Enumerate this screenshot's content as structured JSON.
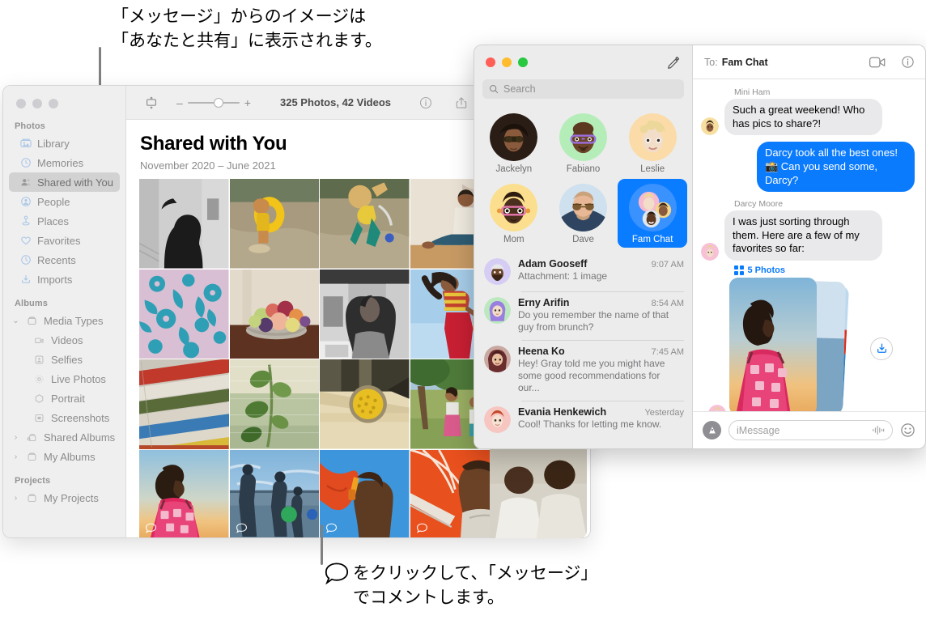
{
  "annotations": {
    "top": "「メッセージ」からのイメージは\n「あなたと共有」に表示されます。",
    "bottom": "をクリックして、「メッセージ」\nでコメントします。"
  },
  "photos_app": {
    "toolbar": {
      "zoom_out": "–",
      "zoom_in": "+",
      "count_label": "325 Photos, 42 Videos"
    },
    "header": {
      "title": "Shared with You",
      "subtitle": "November 2020 – June 2021"
    },
    "sidebar": {
      "groups": [
        {
          "title": "Photos",
          "items": [
            {
              "label": "Library",
              "icon": "library-icon",
              "selected": false
            },
            {
              "label": "Memories",
              "icon": "memories-icon",
              "selected": false
            },
            {
              "label": "Shared with You",
              "icon": "shared-with-you-icon",
              "selected": true
            },
            {
              "label": "People",
              "icon": "people-icon",
              "selected": false
            },
            {
              "label": "Places",
              "icon": "places-icon",
              "selected": false
            },
            {
              "label": "Favorites",
              "icon": "heart-icon",
              "selected": false
            },
            {
              "label": "Recents",
              "icon": "clock-icon",
              "selected": false
            },
            {
              "label": "Imports",
              "icon": "import-icon",
              "selected": false
            }
          ]
        },
        {
          "title": "Albums",
          "items": [
            {
              "label": "Media Types",
              "icon": "folder-icon",
              "chevron": "expanded"
            },
            {
              "label": "Videos",
              "icon": "video-icon",
              "indent": true
            },
            {
              "label": "Selfies",
              "icon": "selfie-icon",
              "indent": true
            },
            {
              "label": "Live Photos",
              "icon": "live-photo-icon",
              "indent": true
            },
            {
              "label": "Portrait",
              "icon": "portrait-icon",
              "indent": true
            },
            {
              "label": "Screenshots",
              "icon": "screenshot-icon",
              "indent": true
            },
            {
              "label": "Shared Albums",
              "icon": "shared-album-icon",
              "chevron": "collapsed"
            },
            {
              "label": "My Albums",
              "icon": "folder-icon",
              "chevron": "collapsed"
            }
          ]
        },
        {
          "title": "Projects",
          "items": [
            {
              "label": "My Projects",
              "icon": "folder-icon",
              "chevron": "collapsed"
            }
          ]
        }
      ]
    },
    "grid": [
      {
        "name": "silhouette-bw",
        "has_comment": false
      },
      {
        "name": "child-yellow-float",
        "has_comment": false
      },
      {
        "name": "child-splashing-water",
        "has_comment": false
      },
      {
        "name": "man-seated-wall",
        "has_comment": false
      },
      {
        "name": "floral-fabric-teal",
        "has_comment": false
      },
      {
        "name": "fruit-bowl",
        "has_comment": false
      },
      {
        "name": "portrait-bw-porch",
        "has_comment": false
      },
      {
        "name": "woman-red-pants",
        "has_comment": false
      },
      {
        "name": "painted-pipes",
        "has_comment": false
      },
      {
        "name": "green-leaves",
        "has_comment": false
      },
      {
        "name": "yellow-bowl-table",
        "has_comment": false
      },
      {
        "name": "family-in-field",
        "has_comment": false
      },
      {
        "name": "woman-pink-sunset",
        "has_comment": true
      },
      {
        "name": "family-at-shore",
        "has_comment": true
      },
      {
        "name": "boy-orange-umbrella",
        "has_comment": true
      },
      {
        "name": "man-orange-parasol",
        "has_comment": true
      },
      {
        "name": "two-men-portrait",
        "has_comment": false
      }
    ]
  },
  "messages_app": {
    "search": {
      "placeholder": "Search"
    },
    "pinned": [
      {
        "label": "Jackelyn",
        "selected": false
      },
      {
        "label": "Fabiano",
        "selected": false
      },
      {
        "label": "Leslie",
        "selected": false
      },
      {
        "label": "Mom",
        "selected": false
      },
      {
        "label": "Dave",
        "selected": false
      },
      {
        "label": "Fam Chat",
        "selected": true
      }
    ],
    "conversations": [
      {
        "name": "Adam Gooseff",
        "time": "9:07 AM",
        "snippet": "Attachment: 1 image"
      },
      {
        "name": "Erny Arifin",
        "time": "8:54 AM",
        "snippet": "Do you remember the name of that guy from brunch?"
      },
      {
        "name": "Heena Ko",
        "time": "7:45 AM",
        "snippet": "Hey! Gray told me you might have some good recommendations for our..."
      },
      {
        "name": "Evania Henkewich",
        "time": "Yesterday",
        "snippet": "Cool! Thanks for letting me know."
      }
    ],
    "thread_header": {
      "to_label": "To:",
      "recipient": "Fam Chat"
    },
    "thread": [
      {
        "sender": "Mini Ham",
        "text": "Such a great weekend! Who has pics to share?!",
        "direction": "in"
      },
      {
        "sender": "",
        "text": "Darcy took all the best ones! 📸 Can you send some, Darcy?",
        "direction": "out"
      },
      {
        "sender": "Darcy Moore",
        "text": "I was just sorting through them. Here are a few of my favorites so far:",
        "direction": "in"
      }
    ],
    "attachment": {
      "label": "5 Photos"
    },
    "composer": {
      "placeholder": "iMessage"
    }
  },
  "colors": {
    "accent_blue": "#0b7bfd",
    "bubble_gray": "#e9e9eb",
    "selected_gray": "#d3d2d2"
  }
}
